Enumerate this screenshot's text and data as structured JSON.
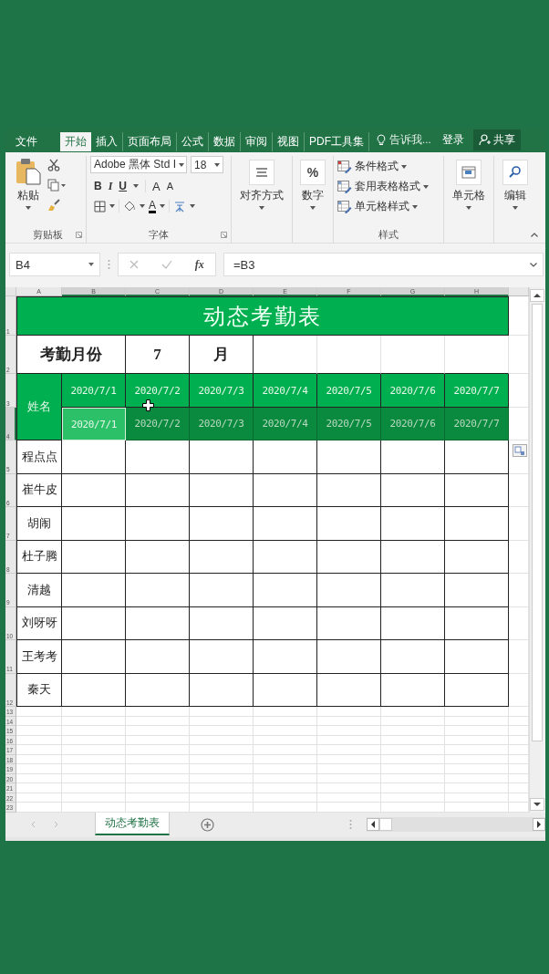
{
  "menu": {
    "tabs": [
      {
        "label": "文件",
        "selected": false
      },
      {
        "label": "开始",
        "selected": true
      },
      {
        "label": "插入",
        "selected": false
      },
      {
        "label": "页面布局",
        "selected": false
      },
      {
        "label": "公式",
        "selected": false
      },
      {
        "label": "数据",
        "selected": false
      },
      {
        "label": "审阅",
        "selected": false
      },
      {
        "label": "视图",
        "selected": false
      },
      {
        "label": "PDF工具集",
        "selected": false
      }
    ],
    "tell_me": "告诉我...",
    "sign_in": "登录",
    "share": "共享"
  },
  "ribbon": {
    "clipboard": {
      "paste": "粘贴",
      "label": "剪贴板"
    },
    "font": {
      "font_name": "Adobe 黑体 Std I",
      "font_size": "18",
      "style_buttons": [
        "B",
        "I",
        "U"
      ],
      "size_buttons": [
        "A",
        "A"
      ],
      "color_button": "A",
      "label": "字体"
    },
    "alignment": {
      "label": "对齐方式"
    },
    "number": {
      "symbol": "%",
      "label": "数字"
    },
    "styles": {
      "items": [
        "条件格式",
        "套用表格格式",
        "单元格样式"
      ],
      "label": "样式"
    },
    "cells": {
      "label": "单元格"
    },
    "editing": {
      "label": "编辑"
    }
  },
  "formula_bar": {
    "name_box": "B4",
    "fx": "fx",
    "formula": "=B3"
  },
  "grid": {
    "columns": [
      {
        "label": "A",
        "selected": false
      },
      {
        "label": "B",
        "selected": true
      },
      {
        "label": "C",
        "selected": true
      },
      {
        "label": "D",
        "selected": true
      },
      {
        "label": "E",
        "selected": true
      },
      {
        "label": "F",
        "selected": true
      },
      {
        "label": "G",
        "selected": true
      },
      {
        "label": "H",
        "selected": true
      }
    ],
    "rows": [
      {
        "label": "1",
        "selected": false
      },
      {
        "label": "2",
        "selected": false
      },
      {
        "label": "3",
        "selected": false
      },
      {
        "label": "4",
        "selected": true
      },
      {
        "label": "5",
        "selected": false
      },
      {
        "label": "6",
        "selected": false
      },
      {
        "label": "7",
        "selected": false
      },
      {
        "label": "8",
        "selected": false
      },
      {
        "label": "9",
        "selected": false
      },
      {
        "label": "10",
        "selected": false
      },
      {
        "label": "11",
        "selected": false
      },
      {
        "label": "12",
        "selected": false
      },
      {
        "label": "13",
        "selected": false
      },
      {
        "label": "14",
        "selected": false
      },
      {
        "label": "15",
        "selected": false
      },
      {
        "label": "16",
        "selected": false
      },
      {
        "label": "17",
        "selected": false
      },
      {
        "label": "18",
        "selected": false
      },
      {
        "label": "19",
        "selected": false
      },
      {
        "label": "20",
        "selected": false
      },
      {
        "label": "21",
        "selected": false
      },
      {
        "label": "22",
        "selected": false
      },
      {
        "label": "23",
        "selected": false
      }
    ]
  },
  "sheet": {
    "title": "动态考勤表",
    "month_label": "考勤月份",
    "month": "7",
    "month_unit": "月",
    "name_header": "姓名",
    "dates": [
      "2020/7/1",
      "2020/7/2",
      "2020/7/3",
      "2020/7/4",
      "2020/7/5",
      "2020/7/6",
      "2020/7/7"
    ],
    "date_copies": [
      {
        "text": "2020/7/1",
        "selected": true,
        "active": true
      },
      {
        "text": "2020/7/2",
        "selected": true,
        "active": false
      },
      {
        "text": "2020/7/3",
        "selected": true,
        "active": false
      },
      {
        "text": "2020/7/4",
        "selected": true,
        "active": false
      },
      {
        "text": "2020/7/5",
        "selected": true,
        "active": false
      },
      {
        "text": "2020/7/6",
        "selected": true,
        "active": false
      },
      {
        "text": "2020/7/7",
        "selected": true,
        "active": false
      }
    ],
    "names": [
      "程点点",
      "崔牛皮",
      "胡闹",
      "杜子腾",
      "清越",
      "刘呀呀",
      "王考考",
      "秦天"
    ]
  },
  "sheet_tabs": [
    {
      "label": "动态考勤表",
      "selected": true
    }
  ]
}
